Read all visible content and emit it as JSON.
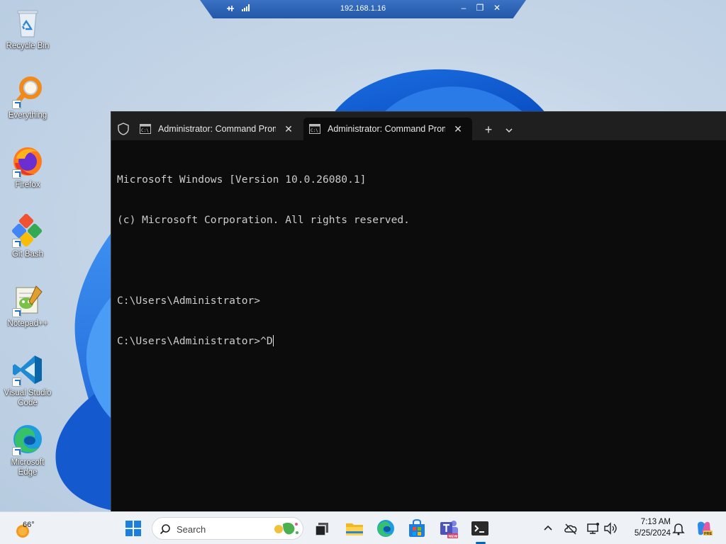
{
  "rdp_bar": {
    "host": "192.168.1.16"
  },
  "desktop_icons": [
    {
      "label": "Recycle Bin",
      "icon": "recycle-bin-icon"
    },
    {
      "label": "Everything",
      "icon": "everything-search-icon"
    },
    {
      "label": "Firefox",
      "icon": "firefox-icon"
    },
    {
      "label": "Git Bash",
      "icon": "git-bash-icon"
    },
    {
      "label": "Notepad++",
      "icon": "notepad-plus-plus-icon"
    },
    {
      "label": "Visual Studio Code",
      "icon": "vscode-icon"
    },
    {
      "label": "Microsoft Edge",
      "icon": "edge-icon"
    }
  ],
  "terminal": {
    "tabs": [
      {
        "title": "Administrator: Command Prompt",
        "active": false
      },
      {
        "title": "Administrator: Command Prompt",
        "active": true
      }
    ],
    "console_lines": [
      "Microsoft Windows [Version 10.0.26080.1]",
      "(c) Microsoft Corporation. All rights reserved.",
      "",
      "C:\\Users\\Administrator>",
      "C:\\Users\\Administrator>^D"
    ]
  },
  "taskbar": {
    "weather_temp": "66°",
    "search_placeholder": "Search",
    "clock_time": "7:13 AM",
    "clock_date": "5/25/2024",
    "pinned_apps": [
      "start-icon",
      "task-view-icon",
      "file-explorer-icon",
      "edge-icon",
      "microsoft-store-icon",
      "teams-icon",
      "terminal-icon"
    ]
  },
  "colors": {
    "terminal_bg": "#0c0c0c",
    "tabbar_bg": "#1f1f1f",
    "console_text": "#cccccc",
    "rdp_bar": "#2f66b9",
    "taskbar_bg": "#eef1f6",
    "accent": "#0067c0"
  }
}
